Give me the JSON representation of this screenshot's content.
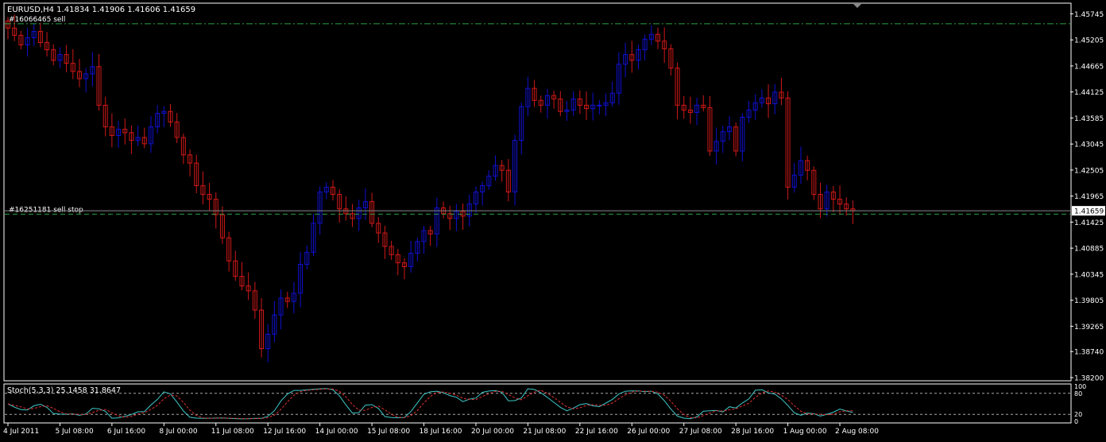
{
  "header": {
    "symbol_line": "EURUSD,H4  1.41834 1.41906 1.41606 1.41659"
  },
  "orders": [
    {
      "label": "#16066465  sell",
      "price": 1.4554,
      "style": "dashdot"
    },
    {
      "label": "#16251181 sell stop",
      "price": 1.4159,
      "style": "dash"
    }
  ],
  "current_price_label": "1.41659",
  "colors": {
    "background": "#000000",
    "bull": "#1010d0",
    "bear": "#d01818",
    "frame": "#ffffff",
    "grid": "#3a3a3a",
    "order_line": "#2ea040",
    "stoch_main": "#40c8c8",
    "stoch_signal": "#e03030"
  },
  "stoch_panel": {
    "title": "Stoch(5,3,3) 25.1458 31.8647",
    "level_labels": [
      "100",
      "80",
      "20",
      "0"
    ],
    "level_values": [
      80,
      20
    ]
  },
  "chart_data": {
    "type": "candlestick",
    "symbol": "EURUSD",
    "timeframe": "H4",
    "y_axis": {
      "ticks": [
        "1.45745",
        "1.45205",
        "1.44665",
        "1.44125",
        "1.43585",
        "1.43045",
        "1.42505",
        "1.41965",
        "1.41425",
        "1.40885",
        "1.40345",
        "1.39805",
        "1.39265",
        "1.38740",
        "1.38200"
      ],
      "range": [
        1.3815,
        1.4595
      ]
    },
    "x_axis": {
      "ticks": [
        "4 Jul 2011",
        "5 Jul 08:00",
        "6 Jul 16:00",
        "8 Jul 00:00",
        "11 Jul 08:00",
        "12 Jul 16:00",
        "14 Jul 00:00",
        "15 Jul 08:00",
        "18 Jul 16:00",
        "20 Jul 00:00",
        "21 Jul 08:00",
        "22 Jul 16:00",
        "26 Jul 00:00",
        "27 Jul 08:00",
        "28 Jul 16:00",
        "1 Aug 00:00",
        "2 Aug 08:00"
      ],
      "tick_bar_index": [
        0,
        8,
        16,
        24,
        32,
        40,
        48,
        56,
        64,
        72,
        80,
        88,
        96,
        104,
        112,
        120,
        128
      ]
    },
    "closes": [
      1.4545,
      1.453,
      1.451,
      1.4525,
      1.4538,
      1.4515,
      1.45,
      1.4478,
      1.449,
      1.4472,
      1.4455,
      1.444,
      1.445,
      1.4465,
      1.4385,
      1.434,
      1.4322,
      1.4335,
      1.4328,
      1.4312,
      1.4318,
      1.4305,
      1.434,
      1.4368,
      1.4372,
      1.435,
      1.4318,
      1.4282,
      1.4265,
      1.4218,
      1.42,
      1.419,
      1.4158,
      1.411,
      1.4062,
      1.403,
      1.401,
      1.4,
      1.396,
      1.388,
      1.391,
      1.395,
      1.3985,
      1.3978,
      1.3995,
      1.4055,
      1.408,
      1.414,
      1.4205,
      1.4215,
      1.42,
      1.417,
      1.416,
      1.415,
      1.4172,
      1.4185,
      1.414,
      1.412,
      1.4092,
      1.4075,
      1.4058,
      1.405,
      1.4078,
      1.4102,
      1.4125,
      1.4118,
      1.4172,
      1.416,
      1.415,
      1.4165,
      1.4155,
      1.418,
      1.4205,
      1.4218,
      1.4238,
      1.426,
      1.425,
      1.4205,
      1.4312,
      1.4382,
      1.442,
      1.4395,
      1.4385,
      1.4405,
      1.4398,
      1.4372,
      1.4375,
      1.4398,
      1.4385,
      1.4378,
      1.4385,
      1.4385,
      1.439,
      1.441,
      1.447,
      1.449,
      1.4478,
      1.45,
      1.4522,
      1.4532,
      1.4518,
      1.4502,
      1.4462,
      1.4385,
      1.4375,
      1.437,
      1.4385,
      1.438,
      1.429,
      1.431,
      1.433,
      1.434,
      1.429,
      1.436,
      1.4375,
      1.439,
      1.44,
      1.4388,
      1.4412,
      1.44,
      1.4215,
      1.424,
      1.427,
      1.425,
      1.42,
      1.417,
      1.4205,
      1.419,
      1.418,
      1.417,
      1.4166
    ],
    "price_stroke_weight": 1
  }
}
